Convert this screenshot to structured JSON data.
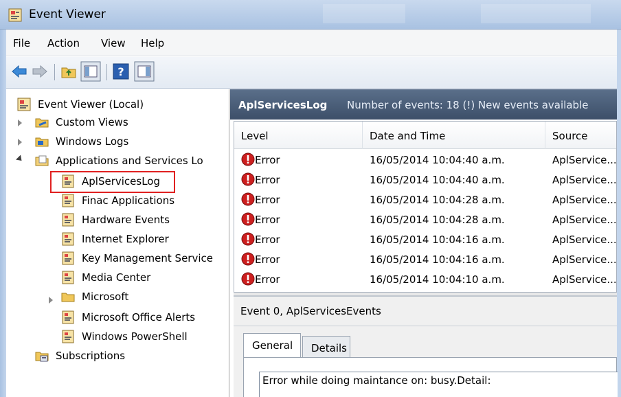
{
  "window": {
    "title": "Event Viewer"
  },
  "menu": [
    "File",
    "Action",
    "View",
    "Help"
  ],
  "toolbar": {
    "buttons": [
      "back-icon",
      "forward-icon",
      "up-folder-icon",
      "show-hide-tree-icon",
      "help-icon",
      "show-hide-action-pane-icon"
    ]
  },
  "tree": {
    "root": "Event Viewer (Local)",
    "items": [
      {
        "label": "Custom Views",
        "icon": "folder-icon",
        "expander": "collapsed"
      },
      {
        "label": "Windows Logs",
        "icon": "folder-icon",
        "expander": "collapsed"
      },
      {
        "label": "Applications and Services Lo",
        "icon": "folder-icon",
        "expander": "expanded"
      },
      {
        "label": "AplServicesLog",
        "icon": "log-icon",
        "selected": true
      },
      {
        "label": "Finac Applications",
        "icon": "log-icon"
      },
      {
        "label": "Hardware Events",
        "icon": "log-icon"
      },
      {
        "label": "Internet Explorer",
        "icon": "log-icon"
      },
      {
        "label": "Key Management Service",
        "icon": "log-icon"
      },
      {
        "label": "Media Center",
        "icon": "log-icon"
      },
      {
        "label": "Microsoft",
        "icon": "folder-icon",
        "expander": "collapsed"
      },
      {
        "label": "Microsoft Office Alerts",
        "icon": "log-icon"
      },
      {
        "label": "Windows PowerShell",
        "icon": "log-icon"
      },
      {
        "label": "Subscriptions",
        "icon": "subscriptions-icon"
      }
    ]
  },
  "content": {
    "log_name": "AplServicesLog",
    "event_count": "Number of events: 18 (!) New events available"
  },
  "grid": {
    "columns": [
      "Level",
      "Date and Time",
      "Source"
    ],
    "rows": [
      {
        "level": "Error",
        "datetime": "16/05/2014 10:04:40 a.m.",
        "source": "AplService..."
      },
      {
        "level": "Error",
        "datetime": "16/05/2014 10:04:40 a.m.",
        "source": "AplService..."
      },
      {
        "level": "Error",
        "datetime": "16/05/2014 10:04:28 a.m.",
        "source": "AplService..."
      },
      {
        "level": "Error",
        "datetime": "16/05/2014 10:04:28 a.m.",
        "source": "AplService..."
      },
      {
        "level": "Error",
        "datetime": "16/05/2014 10:04:16 a.m.",
        "source": "AplService..."
      },
      {
        "level": "Error",
        "datetime": "16/05/2014 10:04:16 a.m.",
        "source": "AplService..."
      },
      {
        "level": "Error",
        "datetime": "16/05/2014 10:04:10 a.m.",
        "source": "AplService..."
      }
    ]
  },
  "detail": {
    "title": "Event 0, AplServicesEvents",
    "tabs": [
      "General",
      "Details"
    ],
    "description": "Error while doing maintance on: busy.Detail:"
  },
  "colors": {
    "error_red": "#cc1f1f",
    "selection_outline": "#e02020",
    "header_bg": "#4a5d78"
  }
}
